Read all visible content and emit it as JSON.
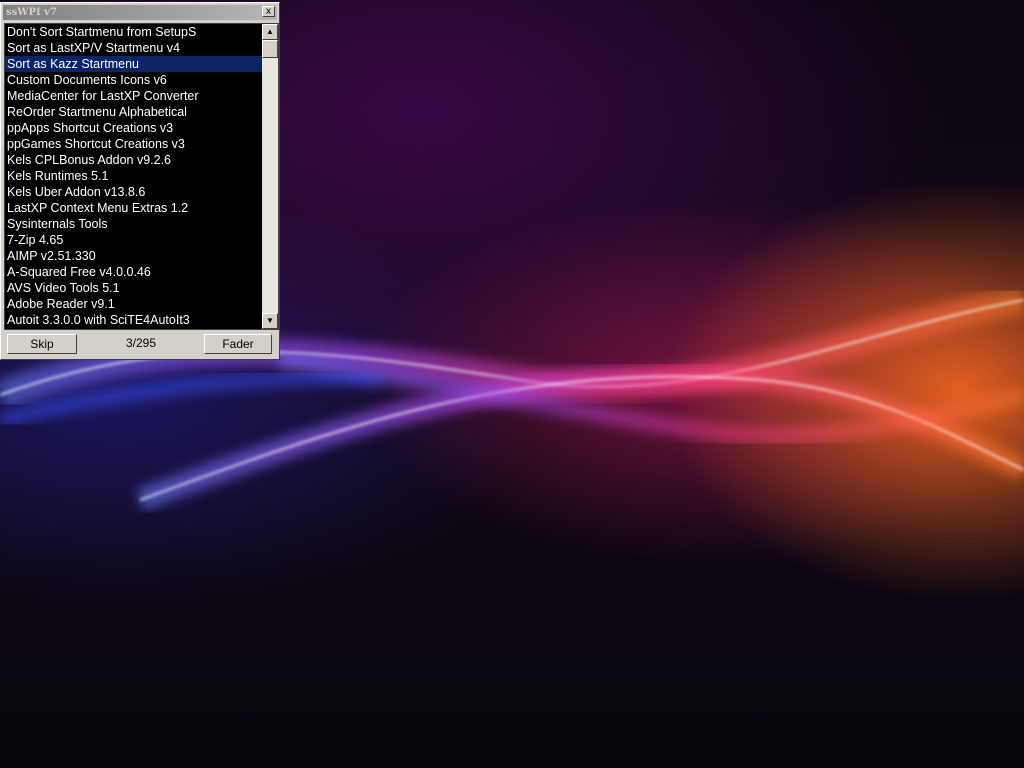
{
  "window": {
    "title": "ssWPI v7",
    "close_symbol": "x"
  },
  "list": {
    "selected_index": 2,
    "items": [
      "Don't Sort Startmenu from SetupS",
      "Sort as LastXP/V Startmenu v4",
      "Sort as Kazz Startmenu",
      "Custom Documents Icons v6",
      "MediaCenter for LastXP Converter",
      "ReOrder Startmenu Alphabetical",
      "ppApps Shortcut Creations v3",
      "ppGames Shortcut Creations v3",
      "Kels CPLBonus Addon v9.2.6",
      "Kels Runtimes 5.1",
      "Kels Uber Addon v13.8.6",
      "LastXP Context Menu Extras 1.2",
      "Sysinternals Tools",
      "7-Zip 4.65",
      "AIMP v2.51.330",
      "A-Squared Free v4.0.0.46",
      "AVS Video Tools 5.1",
      "Adobe Reader v9.1",
      "Autoit 3.3.0.0 with SciTE4AutoIt3"
    ]
  },
  "scrollbar": {
    "up_icon": "arrow-up-icon",
    "down_icon": "arrow-down-icon"
  },
  "footer": {
    "skip_label": "Skip",
    "counter": "3/295",
    "fader_label": "Fader"
  },
  "colors": {
    "selection": "#0a246a",
    "list_background": "#000000",
    "window_face": "#d4d0c8"
  }
}
